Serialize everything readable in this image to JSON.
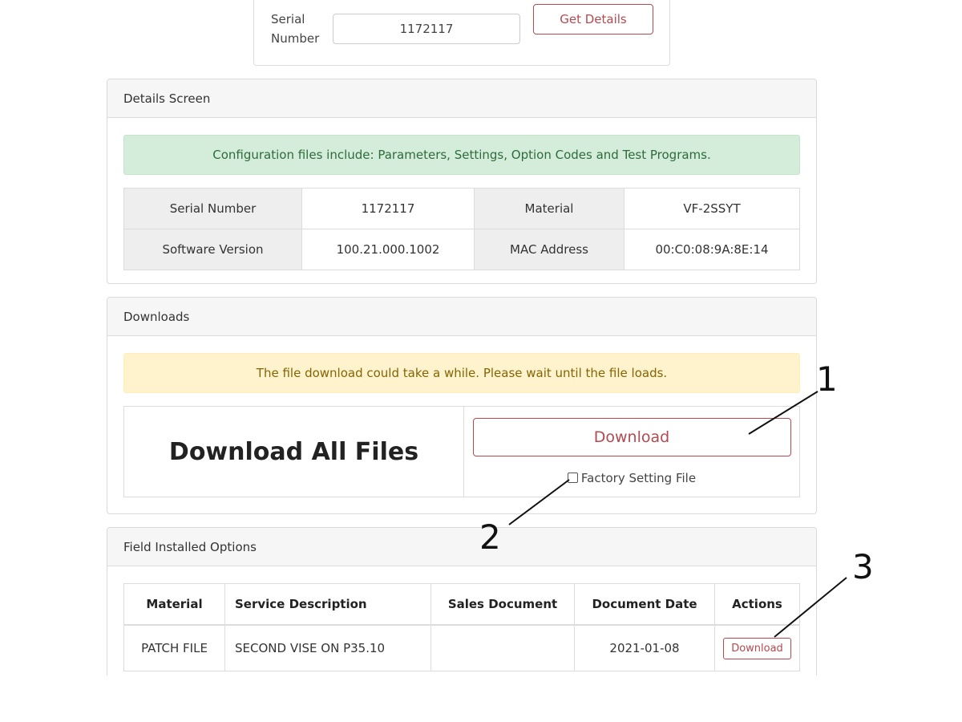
{
  "search": {
    "serial_label_line1": "Serial",
    "serial_label_line2": "Number",
    "serial_value": "1172117",
    "get_details_label": "Get Details"
  },
  "details": {
    "header": "Details Screen",
    "alert": "Configuration files include: Parameters, Settings, Option Codes and Test Programs.",
    "rows": [
      {
        "label1": "Serial Number",
        "value1": "1172117",
        "label2": "Material",
        "value2": "VF-2SSYT"
      },
      {
        "label1": "Software Version",
        "value1": "100.21.000.1002",
        "label2": "MAC Address",
        "value2": "00:C0:08:9A:8E:14"
      }
    ]
  },
  "downloads": {
    "header": "Downloads",
    "alert": "The file download could take a while. Please wait until the file loads.",
    "all_files_label": "Download All Files",
    "download_button": "Download",
    "factory_checkbox_label": "Factory Setting File",
    "factory_checked": false
  },
  "options": {
    "header": "Field Installed Options",
    "columns": [
      "Material",
      "Service Description",
      "Sales Document",
      "Document Date",
      "Actions"
    ],
    "rows": [
      {
        "material": "PATCH FILE",
        "description": "SECOND VISE ON P35.10",
        "sales_document": "",
        "document_date": "2021-01-08",
        "action_label": "Download"
      }
    ]
  },
  "callouts": [
    "1",
    "2",
    "3"
  ],
  "colors": {
    "accent_red": "#b5494f",
    "success_bg": "#d4edda",
    "warning_bg": "#fff3cd",
    "header_bg": "#f6f6f6"
  }
}
